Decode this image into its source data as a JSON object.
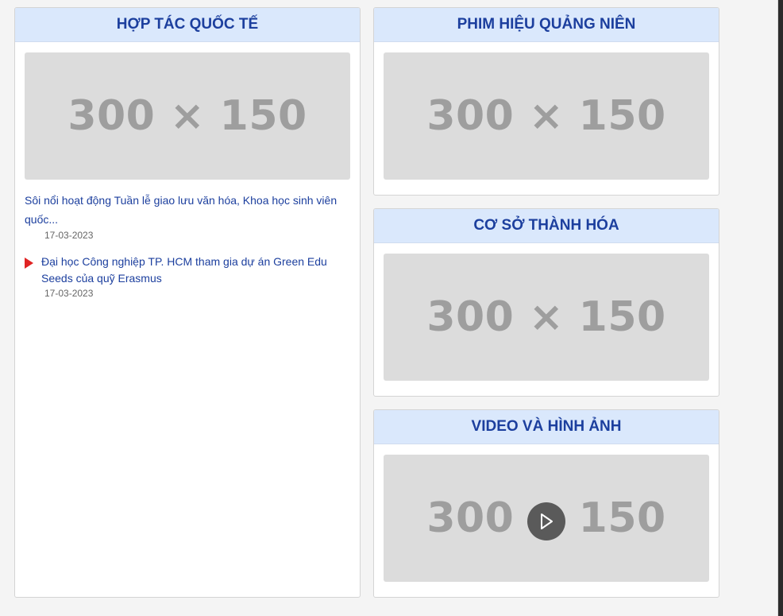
{
  "panels": {
    "hop_tac": {
      "title": "HỢP TÁC QUỐC TẾ",
      "image_text": "300 × 150",
      "news": [
        {
          "title": "Sôi nổi hoạt động Tuần lễ giao lưu văn hóa, Khoa học sinh viên quốc...",
          "date": "17-03-2023"
        },
        {
          "title": "Đại học Công nghiệp TP. HCM tham gia dự án Green Edu Seeds của quỹ Erasmus",
          "date": "17-03-2023"
        }
      ]
    },
    "phim": {
      "title": "PHIM HIỆU QUẢNG NIÊN",
      "image_text": "300 × 150"
    },
    "co_so": {
      "title": "CƠ SỞ THÀNH HÓA",
      "image_text": "300 × 150"
    },
    "video": {
      "title": "VIDEO VÀ HÌNH ẢNH",
      "image_text": "300 × 150"
    }
  },
  "colors": {
    "header_bg": "#dae8fc",
    "header_text": "#1c3f9e",
    "bullet": "#e02424"
  },
  "icons": {
    "bullet": "triangle-right-icon",
    "play": "play-icon"
  }
}
